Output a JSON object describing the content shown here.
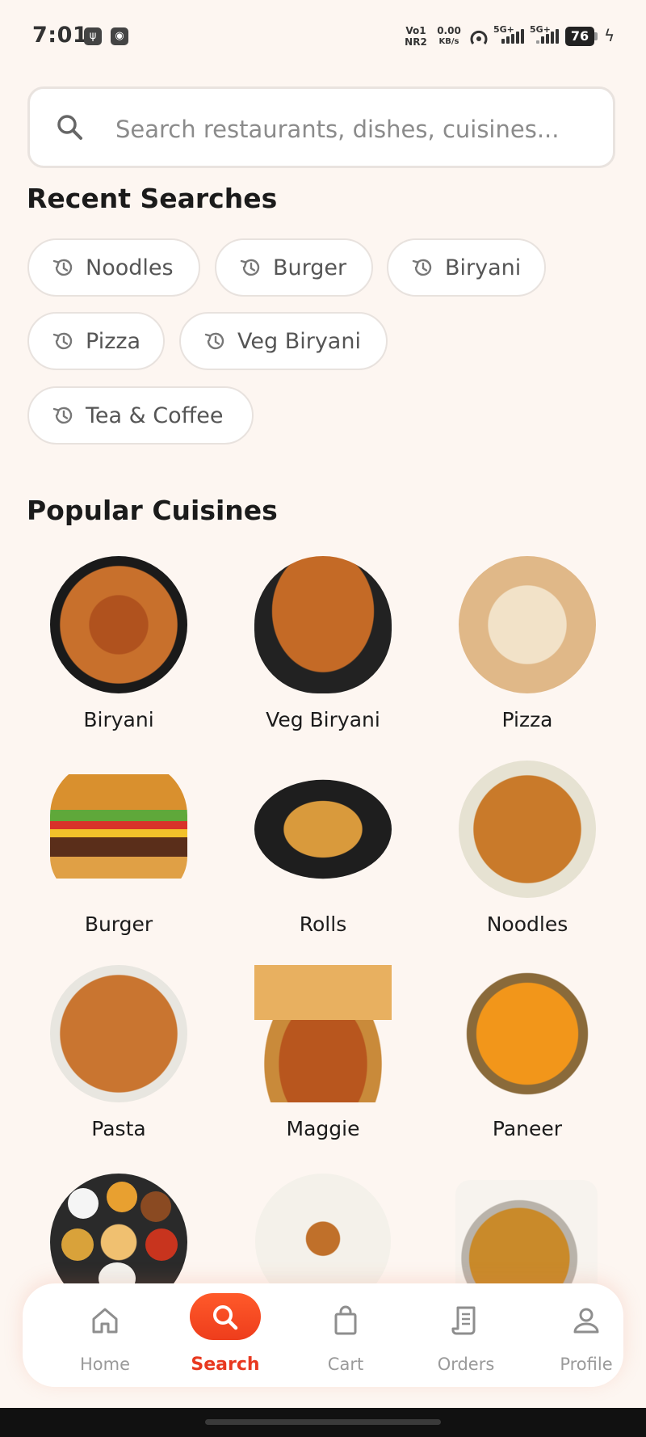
{
  "status_bar": {
    "time": "7:01",
    "left_icons": [
      "usb-icon",
      "hotspot-icon"
    ],
    "vo_line1": "Vo1",
    "vo_line2": "NR2",
    "speed_value": "0.00",
    "speed_unit": "KB/s",
    "sim1_label": "5G+",
    "sim2_label": "5G+",
    "battery": "76"
  },
  "search": {
    "placeholder": "Search restaurants, dishes, cuisines..."
  },
  "recent": {
    "title": "Recent Searches",
    "items": [
      "Noodles",
      "Burger",
      "Biryani",
      "Pizza",
      "Veg Biryani",
      "Tea & Coffee"
    ]
  },
  "popular": {
    "title": "Popular Cuisines",
    "items": [
      "Biryani",
      "Veg Biryani",
      "Pizza",
      "Burger",
      "Rolls",
      "Noodles",
      "Pasta",
      "Maggie",
      "Paneer"
    ]
  },
  "nav": {
    "items": [
      "Home",
      "Search",
      "Cart",
      "Orders",
      "Profile"
    ],
    "active": "Search"
  },
  "colors": {
    "accent": "#ee3d1c",
    "background": "#fdf6f1"
  }
}
